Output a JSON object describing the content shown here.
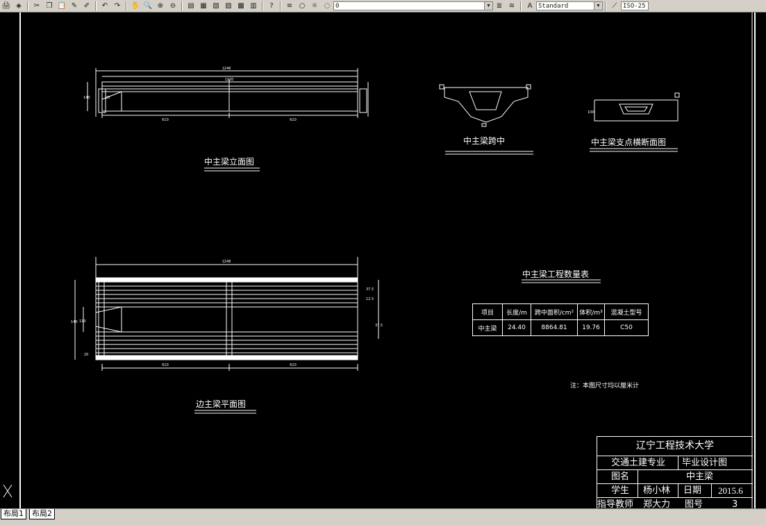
{
  "toolbar": {
    "layer_value": "0",
    "text_style": "Standard",
    "dim_style": "ISO-25"
  },
  "drawing": {
    "views": {
      "mid_girder_elevation": "中主梁立面图",
      "mid_girder_midspan": "中主梁跨中",
      "mid_girder_support_section": "中主梁支点横断面图",
      "side_girder_plan": "边主梁平面图"
    },
    "dims": {
      "total_length": "1248",
      "inner_length": "1220",
      "half_left": "610",
      "half_right": "610",
      "height_140": "140",
      "d20": "20",
      "d100": "100",
      "plan_110": "110",
      "plan_140": "140",
      "plan_20": "20",
      "plan_375a": "37.5",
      "plan_125": "12.5",
      "plan_375b": "37.5"
    },
    "quantity_table": {
      "title": "中主梁工程数量表",
      "headers": [
        "项目",
        "长度/m",
        "跨中面积/cm²",
        "体积/m³",
        "混凝土型号"
      ],
      "row": [
        "中主梁",
        "24.40",
        "8864.81",
        "19.76",
        "C50"
      ]
    },
    "note": "注：本图尺寸均以厘米计",
    "title_block": {
      "school": "辽宁工程技术大学",
      "major": "交通土建专业",
      "design": "毕业设计图",
      "drawing_name_label": "图名",
      "drawing_name": "中主梁",
      "student_label": "学生",
      "student": "杨小林",
      "date_label": "日期",
      "date": "2015.6",
      "teacher_label": "指导教师",
      "teacher": "郑大力",
      "sheet_label": "图号",
      "sheet": "3"
    }
  },
  "tabs": [
    "布局1",
    "布局2"
  ],
  "ucs_icon": "ucs-icon"
}
